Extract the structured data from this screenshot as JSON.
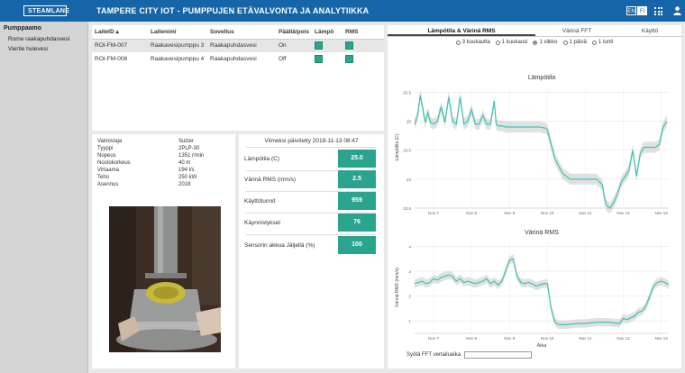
{
  "header": {
    "logo_text": "STEAMLANE",
    "title": "TAMPERE CITY IOT - PUMPPUJEN ETÄVALVONTA JA ANALYTIIKKA",
    "lang_en": "EN",
    "lang_fi": "FI",
    "apps_icon": "grid-icon",
    "user_icon": "user-icon"
  },
  "sidebar": {
    "title": "Pumppaamo",
    "items": [
      {
        "label": "Rome raakapuhdasvesi"
      },
      {
        "label": "Viertie hulevesi"
      }
    ]
  },
  "device_table": {
    "headers": [
      "LaiteID ▴",
      "Laitenimi",
      "Sovellus",
      "Päällä/pois",
      "Lämpö",
      "RMS"
    ],
    "rows": [
      {
        "id": "ROI-FM-007",
        "name": "Raakavesipumppu 3",
        "app": "Raakapuhdasvesi",
        "state": "On",
        "temp_status": "ok",
        "rms_status": "ok"
      },
      {
        "id": "ROI-FM-008",
        "name": "Raakavesipumppu 4",
        "app": "Raakapuhdasvesi",
        "state": "Off",
        "temp_status": "ok",
        "rms_status": "ok"
      }
    ]
  },
  "specs": [
    {
      "key": "Valmistaja",
      "value": "Sulzer"
    },
    {
      "key": "Tyyppi",
      "value": "2PLP-30"
    },
    {
      "key": "Nopeus",
      "value": "1351 r/min"
    },
    {
      "key": "Nostokorkeus",
      "value": "40 m"
    },
    {
      "key": "Virtaama",
      "value": "194 l/s"
    },
    {
      "key": "Teho",
      "value": "250 kW"
    },
    {
      "key": "Asennus",
      "value": "2018"
    }
  ],
  "metrics": {
    "updated": "Viimeksi päivitetty 2018-11-13 08:47",
    "items": [
      {
        "label": "Lämpötila (C)",
        "value": "25.0"
      },
      {
        "label": "Värinä RMS (mm/s)",
        "value": "2.5"
      },
      {
        "label": "Käyttötunnit",
        "value": "959"
      },
      {
        "label": "Käynnistykset",
        "value": "76"
      },
      {
        "label": "Sensorin akkua Jäljellä (%)",
        "value": "100"
      }
    ]
  },
  "chart_panel": {
    "tabs": [
      "Lämpötila & Värinä RMS",
      "Värinä FFT",
      "Käyttö"
    ],
    "active_tab": 0,
    "range_options": [
      "3 kuukautta",
      "1 kuukausi",
      "1 viikko",
      "1 päivä",
      "1 tunti"
    ],
    "selected_range": 2,
    "fft_label": "Syötä FFT vertailuaika",
    "fft_value": ""
  },
  "colors": {
    "accent": "#1565a8",
    "line": "#3cc6b4",
    "band": "#c9c9c9",
    "status_ok": "#2ba48e"
  },
  "chart_data": [
    {
      "type": "line",
      "title": "Lämpötila",
      "xlabel": "Aika",
      "ylabel": "Lämpötila (C)",
      "x_ticks": [
        "Nov 7",
        "Nov 8",
        "Nov 9",
        "Nov 10",
        "Nov 11",
        "Nov 12",
        "Nov 13"
      ],
      "y_ticks": [
        23.5,
        24,
        24.5,
        25,
        25.5
      ],
      "ylim": [
        23.5,
        25.6
      ],
      "x_range": [
        6.5,
        13.2
      ],
      "grid": true,
      "series": [
        {
          "x": [
            6.5,
            6.58,
            6.65,
            6.72,
            6.78,
            6.85,
            6.92,
            7.0,
            7.1,
            7.2,
            7.3,
            7.4,
            7.5,
            7.6,
            7.7,
            7.8,
            7.9,
            8.0,
            8.1,
            8.2,
            8.3,
            8.4,
            8.5,
            8.6,
            8.65,
            8.7,
            8.8,
            8.9,
            9.0,
            9.3,
            9.6,
            9.8,
            9.95,
            10.0,
            10.1,
            10.2,
            10.4,
            10.6,
            10.8,
            11.0,
            11.3,
            11.45,
            11.5,
            11.55,
            11.65,
            11.75,
            11.85,
            11.95,
            12.05,
            12.15,
            12.25,
            12.35,
            12.45,
            12.55,
            12.65,
            12.75,
            12.85,
            12.95,
            13.05,
            13.15
          ],
          "y": [
            24.95,
            25.1,
            25.45,
            25.2,
            24.98,
            25.15,
            24.98,
            24.95,
            25.0,
            25.25,
            24.98,
            25.42,
            25.0,
            24.95,
            25.42,
            24.95,
            25.0,
            25.2,
            24.95,
            24.95,
            25.1,
            24.95,
            24.95,
            25.35,
            24.95,
            24.92,
            24.92,
            24.9,
            24.9,
            24.9,
            24.9,
            24.9,
            24.88,
            24.85,
            24.6,
            24.35,
            24.1,
            24.0,
            24.0,
            24.0,
            24.0,
            23.9,
            23.7,
            23.55,
            23.5,
            23.6,
            23.75,
            23.95,
            24.05,
            24.15,
            24.5,
            24.05,
            24.45,
            24.55,
            24.55,
            24.55,
            24.55,
            24.6,
            24.9,
            25.0
          ]
        }
      ]
    },
    {
      "type": "line",
      "title": "Värinä RMS",
      "xlabel": "Aika",
      "ylabel": "Värinä RMS (mm/s)",
      "x_ticks": [
        "Nov 7",
        "Nov 8",
        "Nov 9",
        "Nov 10",
        "Nov 11",
        "Nov 12",
        "Nov 13"
      ],
      "y_ticks": [
        1,
        2,
        3,
        4
      ],
      "ylim": [
        0.5,
        4.2
      ],
      "x_range": [
        6.5,
        13.2
      ],
      "grid": true,
      "series": [
        {
          "x": [
            6.5,
            6.6,
            6.7,
            6.8,
            6.9,
            7.0,
            7.1,
            7.2,
            7.3,
            7.4,
            7.5,
            7.6,
            7.7,
            7.8,
            7.9,
            8.0,
            8.1,
            8.2,
            8.3,
            8.4,
            8.5,
            8.6,
            8.7,
            8.8,
            8.9,
            9.0,
            9.1,
            9.2,
            9.3,
            9.4,
            9.5,
            9.6,
            9.7,
            9.8,
            9.9,
            10.0,
            10.1,
            10.2,
            10.3,
            10.5,
            10.8,
            11.0,
            11.3,
            11.6,
            11.9,
            12.0,
            12.1,
            12.3,
            12.4,
            12.5,
            12.6,
            12.7,
            12.8,
            12.9,
            13.0,
            13.1,
            13.2
          ],
          "y": [
            2.5,
            2.55,
            2.6,
            2.5,
            2.55,
            2.7,
            2.65,
            2.75,
            2.8,
            2.85,
            2.8,
            2.6,
            2.7,
            2.55,
            2.6,
            2.55,
            2.5,
            2.55,
            2.6,
            2.7,
            2.5,
            2.6,
            2.45,
            2.6,
            3.0,
            3.45,
            3.5,
            2.8,
            2.55,
            2.5,
            2.55,
            2.5,
            2.4,
            2.45,
            2.5,
            2.5,
            1.5,
            0.95,
            0.85,
            0.85,
            0.9,
            0.9,
            0.95,
            0.95,
            0.9,
            1.1,
            1.05,
            1.2,
            1.35,
            1.4,
            1.6,
            2.0,
            2.4,
            2.55,
            2.6,
            2.55,
            2.45
          ]
        }
      ]
    }
  ]
}
